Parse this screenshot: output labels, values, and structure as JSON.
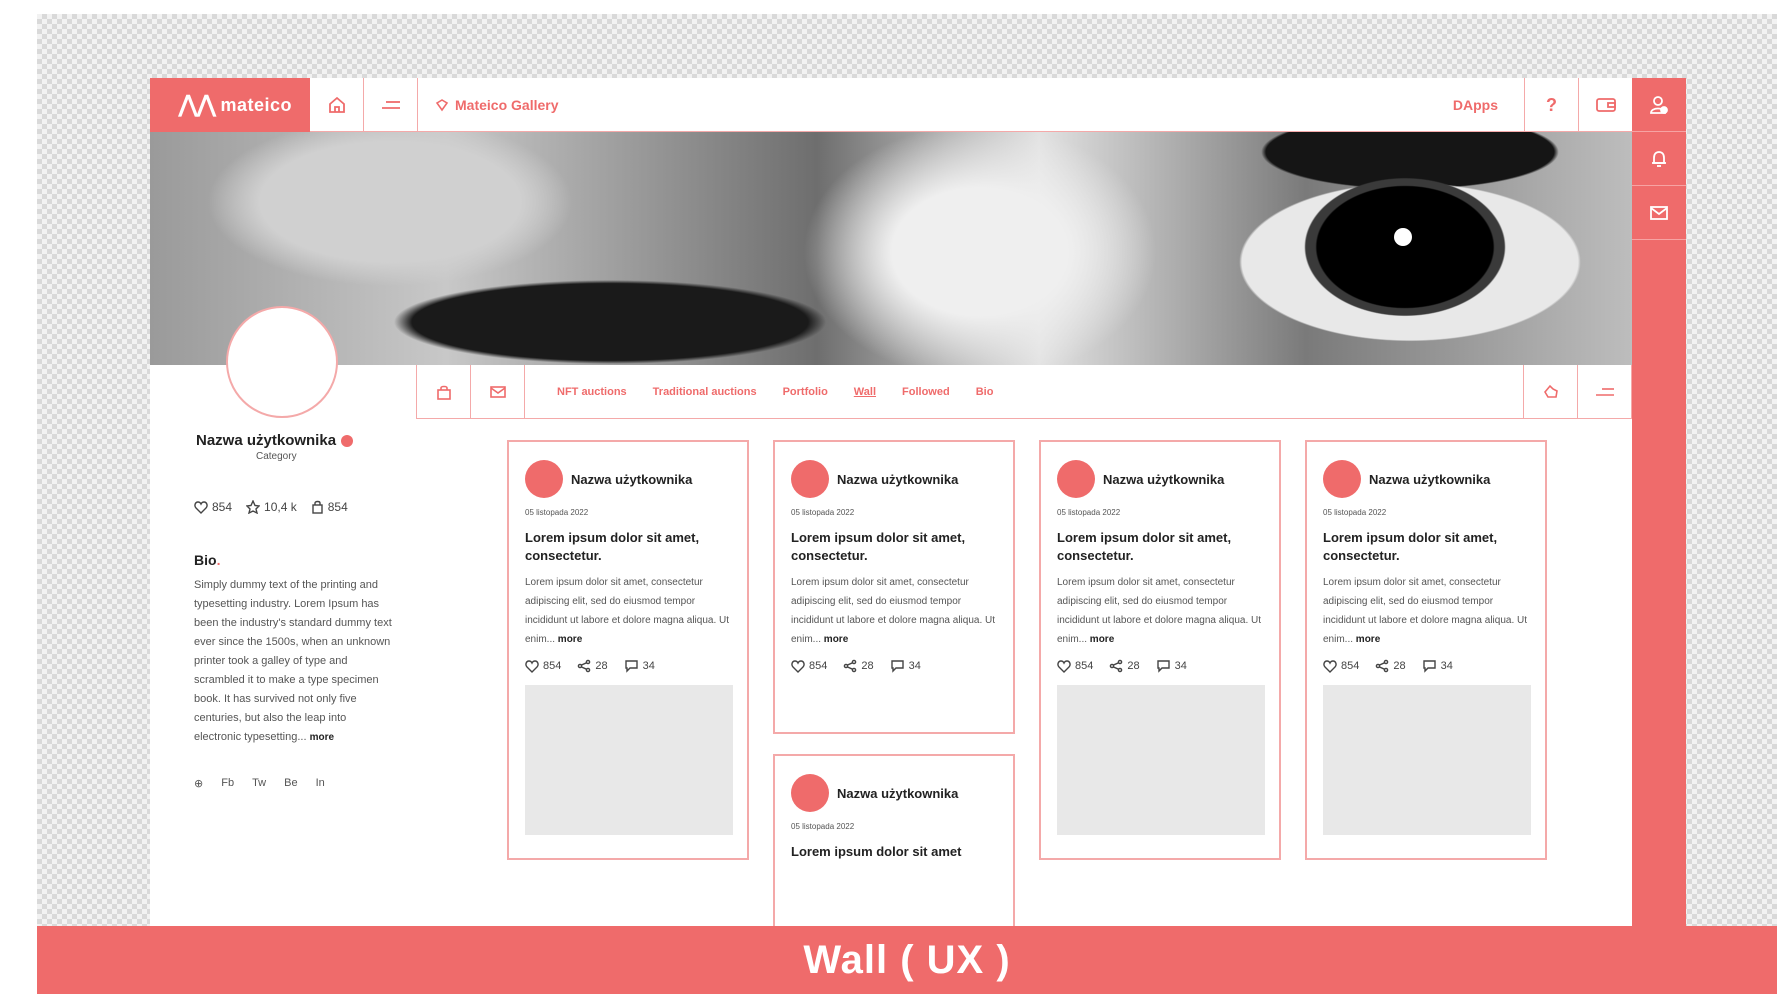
{
  "app": {
    "logo_text": "mateico",
    "gallery_title": "Mateico Gallery",
    "dapps_label": "DApps",
    "help_label": "?"
  },
  "subnav": {
    "tabs": [
      {
        "label": "NFT auctions"
      },
      {
        "label": "Traditional auctions"
      },
      {
        "label": "Portfolio"
      },
      {
        "label": "Wall"
      },
      {
        "label": "Followed"
      },
      {
        "label": "Bio"
      }
    ]
  },
  "profile": {
    "username": "Nazwa użytkownika",
    "category": "Category",
    "stats": {
      "likes": "854",
      "stars": "10,4 k",
      "bag": "854"
    },
    "bio_heading": "Bio",
    "bio_dot": ".",
    "bio_text": "Simply dummy text of the printing and typesetting industry. Lorem Ipsum has been the industry's standard dummy text ever since the 1500s, when an unknown printer took a galley of type and scrambled it to make a type specimen book. It has survived not only five centuries, but also the leap into electronic typesetting...",
    "more": "more",
    "social": [
      "Fb",
      "Tw",
      "Be",
      "In"
    ]
  },
  "cards": [
    {
      "author": "Nazwa użytkownika",
      "date": "05 listopada 2022",
      "title": "Lorem ipsum dolor sit amet, consectetur.",
      "body": "Lorem ipsum dolor sit amet, consectetur adipiscing elit, sed do eiusmod tempor incididunt ut labore et dolore magna aliqua. Ut enim...",
      "more": "more",
      "likes": "854",
      "shares": "28",
      "comments": "34"
    },
    {
      "author": "Nazwa użytkownika",
      "date": "05 listopada 2022",
      "title": "Lorem ipsum dolor sit amet, consectetur.",
      "body": "Lorem ipsum dolor sit amet, consectetur adipiscing elit, sed do eiusmod tempor incididunt ut labore et dolore magna aliqua. Ut enim...",
      "more": "more",
      "likes": "854",
      "shares": "28",
      "comments": "34"
    },
    {
      "author": "Nazwa użytkownika",
      "date": "05 listopada 2022",
      "title": "Lorem ipsum dolor sit amet, consectetur.",
      "body": "Lorem ipsum dolor sit amet, consectetur adipiscing elit, sed do eiusmod tempor incididunt ut labore et dolore magna aliqua. Ut enim...",
      "more": "more",
      "likes": "854",
      "shares": "28",
      "comments": "34"
    },
    {
      "author": "Nazwa użytkownika",
      "date": "05 listopada 2022",
      "title": "Lorem ipsum dolor sit amet, consectetur.",
      "body": "Lorem ipsum dolor sit amet, consectetur adipiscing elit, sed do eiusmod tempor incididunt ut labore et dolore magna aliqua. Ut enim...",
      "more": "more",
      "likes": "854",
      "shares": "28",
      "comments": "34"
    },
    {
      "author": "Nazwa użytkownika",
      "date": "05 listopada 2022",
      "title": "Lorem ipsum dolor sit amet"
    }
  ],
  "banner": {
    "label": "Wall ( UX )"
  },
  "colors": {
    "accent": "#ef6b6b",
    "accent_light": "#f4a9a9",
    "placeholder": "#e8e8e8"
  },
  "icons": {
    "nav": [
      "home-icon",
      "menu-icon",
      "gallery-icon",
      "wallet-icon"
    ],
    "sidebar": [
      "user-icon",
      "bell-icon",
      "mail-icon"
    ],
    "subnav": [
      "bag-icon",
      "mail-icon",
      "hand-icon",
      "menu-icon"
    ]
  }
}
